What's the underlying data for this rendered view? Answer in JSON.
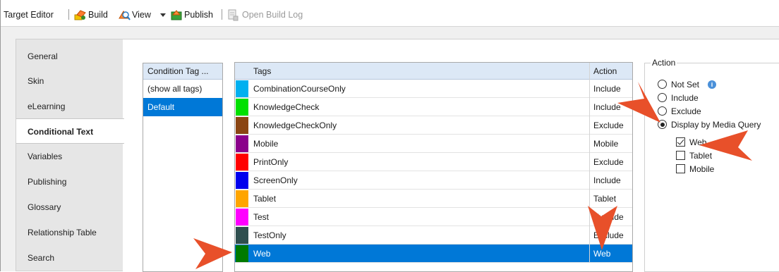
{
  "toolbar": {
    "title": "Target Editor",
    "build": "Build",
    "view": "View",
    "publish": "Publish",
    "open_build_log": "Open Build Log"
  },
  "tabs": [
    {
      "label": "General"
    },
    {
      "label": "Skin"
    },
    {
      "label": "eLearning"
    },
    {
      "label": "Conditional Text",
      "active": true
    },
    {
      "label": "Variables"
    },
    {
      "label": "Publishing"
    },
    {
      "label": "Glossary"
    },
    {
      "label": "Relationship Table"
    },
    {
      "label": "Search"
    }
  ],
  "condition_tag_sets": {
    "header": "Condition Tag ...",
    "items": [
      "(show all tags)",
      "Default"
    ],
    "selected": "Default"
  },
  "tags_grid": {
    "columns": [
      "Tags",
      "Action"
    ],
    "rows": [
      {
        "name": "CombinationCourseOnly",
        "action": "Include",
        "color": "#00b0f0"
      },
      {
        "name": "KnowledgeCheck",
        "action": "Include",
        "color": "#00e000"
      },
      {
        "name": "KnowledgeCheckOnly",
        "action": "Exclude",
        "color": "#8b4513"
      },
      {
        "name": "Mobile",
        "action": "Mobile",
        "color": "#8b008b"
      },
      {
        "name": "PrintOnly",
        "action": "Exclude",
        "color": "#ff0000"
      },
      {
        "name": "ScreenOnly",
        "action": "Include",
        "color": "#0000ee"
      },
      {
        "name": "Tablet",
        "action": "Tablet",
        "color": "#ffa500"
      },
      {
        "name": "Test",
        "action": "Exclude",
        "color": "#ff00ff"
      },
      {
        "name": "TestOnly",
        "action": "Exclude",
        "color": "#2f4f4f"
      },
      {
        "name": "Web",
        "action": "Web",
        "color": "#007a00",
        "selected": true
      }
    ]
  },
  "action_group": {
    "legend": "Action",
    "options": [
      {
        "label": "Not Set",
        "checked": false
      },
      {
        "label": "Include",
        "checked": false
      },
      {
        "label": "Exclude",
        "checked": false
      },
      {
        "label": "Display by Media Query",
        "checked": true
      }
    ],
    "media": [
      {
        "label": "Web",
        "checked": true
      },
      {
        "label": "Tablet",
        "checked": false
      },
      {
        "label": "Mobile",
        "checked": false
      }
    ]
  },
  "callout_color": "#e8502a"
}
